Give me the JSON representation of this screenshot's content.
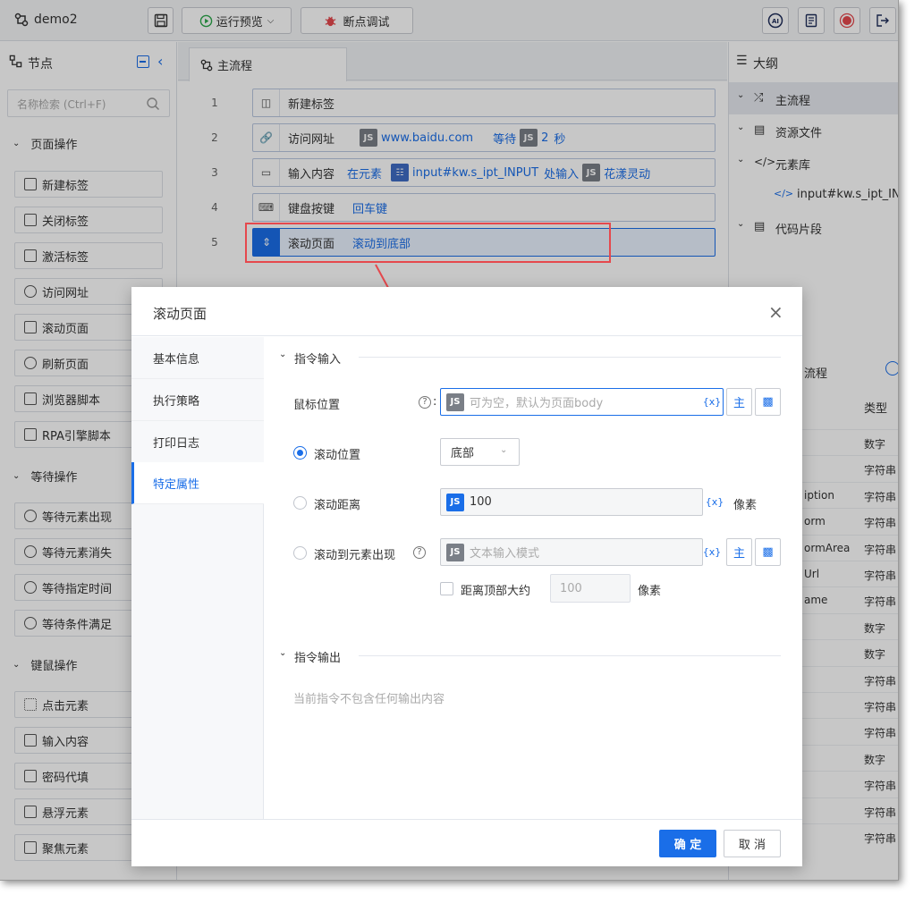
{
  "app": {
    "title": "demo2",
    "run_preview": "运行预览",
    "debug": "断点调试"
  },
  "left_panel": {
    "title": "节点",
    "search_placeholder": "名称检索 (Ctrl+F)",
    "groups": [
      {
        "label": "页面操作",
        "items": [
          "新建标签",
          "关闭标签",
          "激活标签",
          "访问网址",
          "滚动页面",
          "刷新页面",
          "浏览器脚本",
          "RPA引擎脚本"
        ]
      },
      {
        "label": "等待操作",
        "items": [
          "等待元素出现",
          "等待元素消失",
          "等待指定时间",
          "等待条件满足"
        ]
      },
      {
        "label": "键鼠操作",
        "items": [
          "点击元素",
          "输入内容",
          "密码代填",
          "悬浮元素",
          "聚焦元素"
        ]
      }
    ]
  },
  "editor": {
    "tab": "主流程",
    "rows": [
      {
        "num": "1",
        "name": "新建标签",
        "parts": []
      },
      {
        "num": "2",
        "name": "访问网址",
        "js1": "JS",
        "val1": "www.baidu.com",
        "mid": "等待",
        "js2": "JS",
        "val2": "2",
        "tail": "秒"
      },
      {
        "num": "3",
        "name": "输入内容",
        "pre": "在元素",
        "el": "input#kw.s_ipt_INPUT",
        "mid": "处输入",
        "js2": "JS",
        "val2": "花漾灵动"
      },
      {
        "num": "4",
        "name": "键盘按键",
        "val1": "回车键"
      },
      {
        "num": "5",
        "name": "滚动页面",
        "val1": "滚动到底部"
      }
    ]
  },
  "right_panel": {
    "title": "大纲",
    "tree": [
      "主流程",
      "资源文件",
      "元素库",
      "input#kw.s_ipt_INF",
      "代码片段"
    ],
    "sub_title": "流程",
    "col_type": "类型",
    "vars": [
      {
        "name": "",
        "type": "数字"
      },
      {
        "name": "",
        "type": "字符串"
      },
      {
        "name": "iption",
        "type": "字符串"
      },
      {
        "name": "orm",
        "type": "字符串"
      },
      {
        "name": "ormArea",
        "type": "字符串"
      },
      {
        "name": "Url",
        "type": "字符串"
      },
      {
        "name": "ame",
        "type": "字符串"
      },
      {
        "name": "",
        "type": "数字"
      },
      {
        "name": "",
        "type": "数字"
      },
      {
        "name": "",
        "type": "字符串"
      },
      {
        "name": "",
        "type": "字符串"
      },
      {
        "name": "",
        "type": "字符串"
      },
      {
        "name": "",
        "type": "数字"
      },
      {
        "name": "",
        "type": "字符串"
      },
      {
        "name": "",
        "type": "字符串"
      },
      {
        "name": "",
        "type": "字符串"
      }
    ]
  },
  "modal": {
    "title": "滚动页面",
    "tabs": [
      "基本信息",
      "执行策略",
      "打印日志",
      "特定属性"
    ],
    "active_tab": "特定属性",
    "input_section": "指令输入",
    "output_section": "指令输出",
    "mouse_label": "鼠标位置",
    "mouse_placeholder": "可为空，默认为页面body",
    "scroll_pos_label": "滚动位置",
    "scroll_pos_value": "底部",
    "scroll_dist_label": "滚动距离",
    "scroll_dist_value": "100",
    "pixel_unit": "像素",
    "scroll_el_label": "滚动到元素出现",
    "scroll_el_placeholder": "文本输入模式",
    "top_dist_label": "距离顶部大约",
    "top_dist_value": "100",
    "output_empty": "当前指令不包含任何输出内容",
    "var_btn": "{x}",
    "confirm": "确 定",
    "cancel": "取 消",
    "js": "JS"
  },
  "colors": {
    "accent": "#1a6ee8",
    "highlight_box": "#e5484d"
  }
}
